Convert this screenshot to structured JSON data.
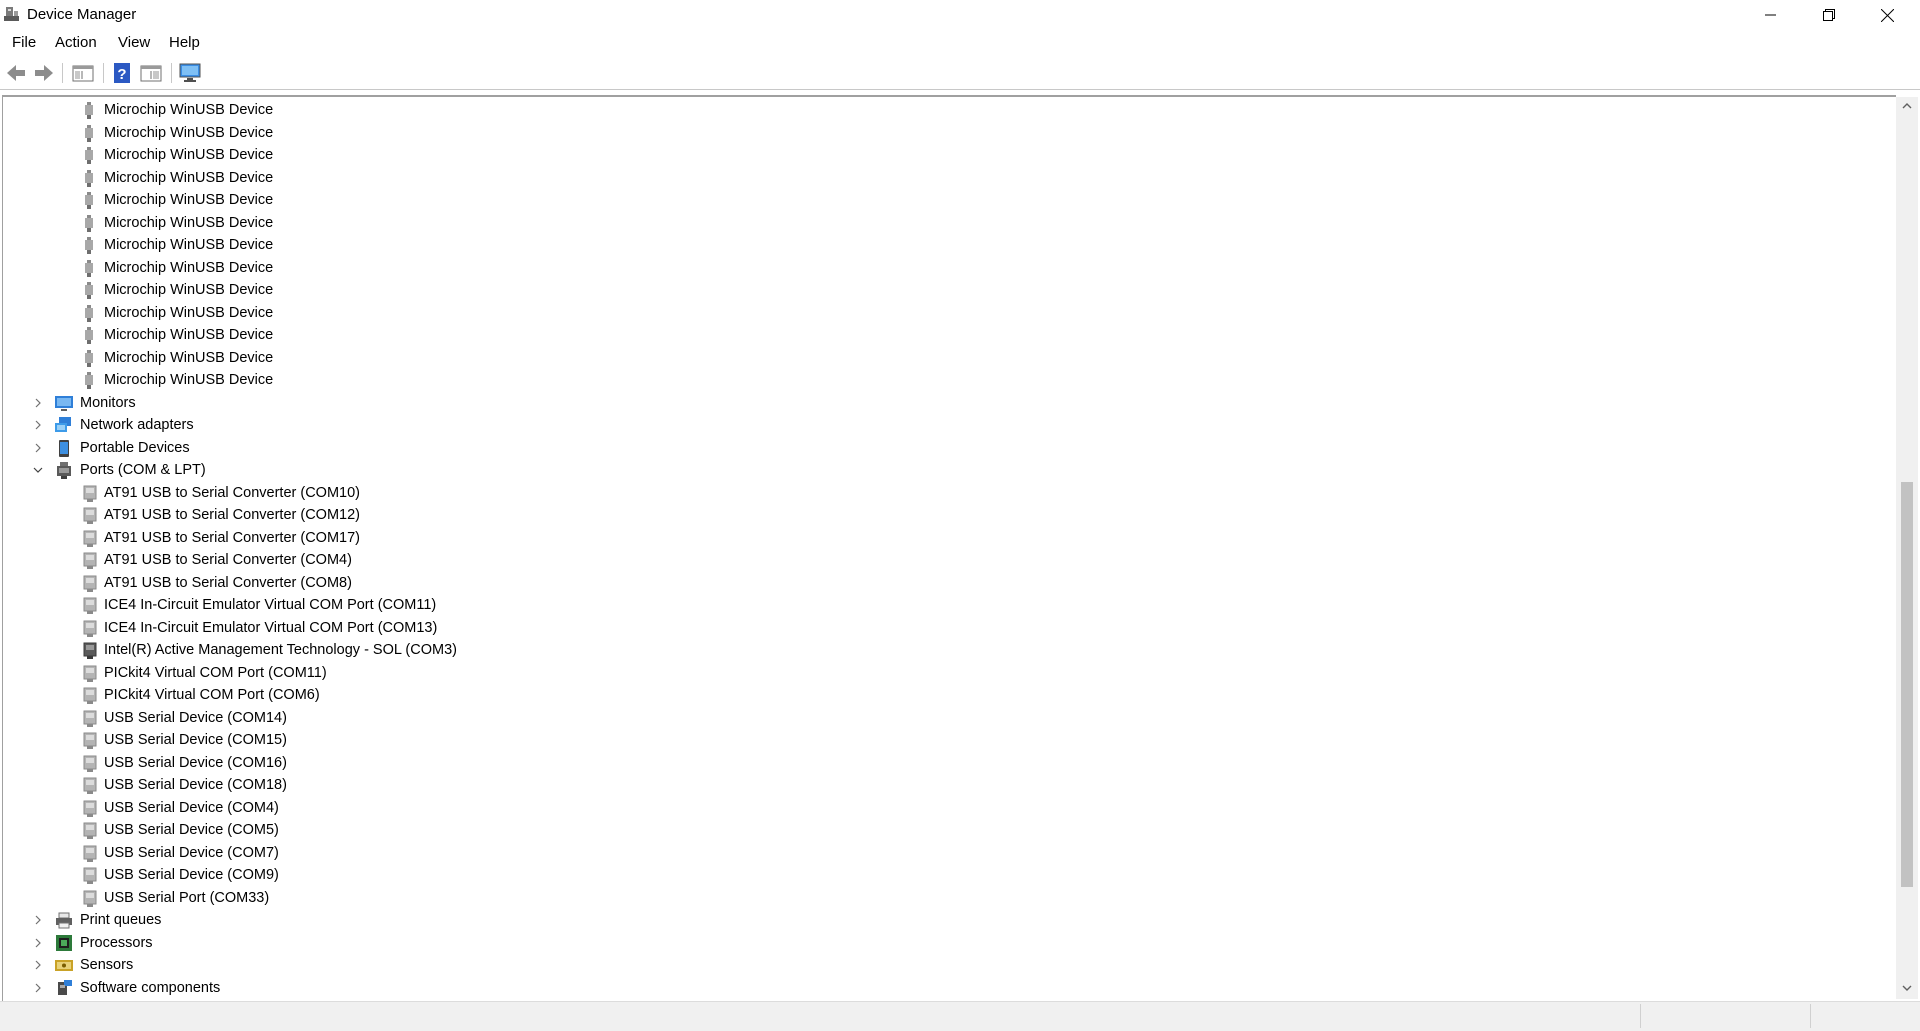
{
  "window": {
    "title": "Device Manager",
    "controls": [
      "minimize",
      "restore",
      "close"
    ]
  },
  "menu": {
    "file": "File",
    "action": "Action",
    "view": "View",
    "help": "Help"
  },
  "toolbar": {
    "icons": [
      "back-arrow-icon",
      "forward-arrow-icon",
      "show-hide-console-tree-icon",
      "help-icon",
      "properties-pane-icon",
      "monitor-scan-icon"
    ]
  },
  "tree": {
    "winusb_items": [
      "Microchip WinUSB Device",
      "Microchip WinUSB Device",
      "Microchip WinUSB Device",
      "Microchip WinUSB Device",
      "Microchip WinUSB Device",
      "Microchip WinUSB Device",
      "Microchip WinUSB Device",
      "Microchip WinUSB Device",
      "Microchip WinUSB Device",
      "Microchip WinUSB Device",
      "Microchip WinUSB Device",
      "Microchip WinUSB Device",
      "Microchip WinUSB Device"
    ],
    "monitors": "Monitors",
    "network_adapters": "Network adapters",
    "portable_devices": "Portable Devices",
    "ports": "Ports (COM & LPT)",
    "port_items": [
      "AT91 USB to Serial Converter (COM10)",
      "AT91 USB to Serial Converter (COM12)",
      "AT91 USB to Serial Converter (COM17)",
      "AT91 USB to Serial Converter (COM4)",
      "AT91 USB to Serial Converter (COM8)",
      "ICE4 In-Circuit Emulator Virtual COM Port (COM11)",
      "ICE4 In-Circuit Emulator Virtual COM Port (COM13)",
      "Intel(R) Active Management Technology - SOL (COM3)",
      "PICkit4 Virtual COM Port (COM11)",
      "PICkit4 Virtual COM Port (COM6)",
      "USB Serial Device (COM14)",
      "USB Serial Device (COM15)",
      "USB Serial Device (COM16)",
      "USB Serial Device (COM18)",
      "USB Serial Device (COM4)",
      "USB Serial Device (COM5)",
      "USB Serial Device (COM7)",
      "USB Serial Device (COM9)",
      "USB Serial Port (COM33)"
    ],
    "print_queues": "Print queues",
    "processors": "Processors",
    "sensors": "Sensors",
    "software_components": "Software components"
  }
}
